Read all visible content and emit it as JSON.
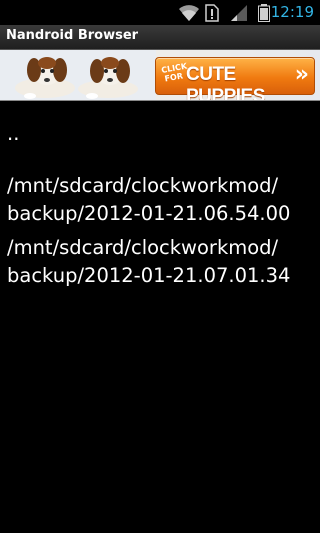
{
  "status_bar": {
    "time": "12:19",
    "icons": [
      "wifi-icon",
      "sim-alert-icon",
      "signal-icon",
      "battery-icon"
    ],
    "accent_color": "#33b5e5"
  },
  "app": {
    "title": "Nandroid Browser"
  },
  "ad": {
    "click_text": "CLICK FOR",
    "main_text": "CUTE PUPPIES",
    "arrow": "»"
  },
  "files": {
    "parent": "..",
    "items": [
      {
        "line1": "/mnt/sdcard/clockworkmod/",
        "line2": "backup/2012-01-21.06.54.00"
      },
      {
        "line1": "/mnt/sdcard/clockworkmod/",
        "line2": "backup/2012-01-21.07.01.34"
      }
    ]
  }
}
